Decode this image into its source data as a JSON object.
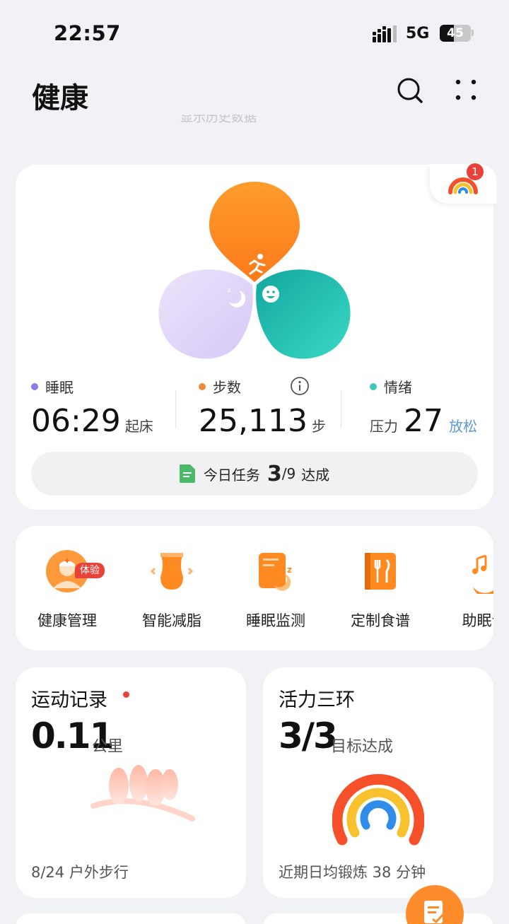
{
  "status_bar": {
    "time": "22:57",
    "network": "5G",
    "battery": "45",
    "battery_level": 0.45
  },
  "header": {
    "title": "健康",
    "faded_text": "显示历史数据",
    "search_icon": "search-icon",
    "more_icon": "more-dots-icon"
  },
  "rings_badge": {
    "count": "1"
  },
  "petal_colors": {
    "sleep": "#e5dcfa",
    "steps": "#ff8a1f",
    "mood": "#22b8aa"
  },
  "metrics": {
    "sleep": {
      "label": "睡眠",
      "value": "06:29",
      "unit": "起床",
      "color": "#8c7ae6"
    },
    "steps": {
      "label": "步数",
      "value": "25,113",
      "unit": "步",
      "color": "#f08a38"
    },
    "mood": {
      "label": "情绪",
      "prefix": "压力",
      "value": "27",
      "status": "放松",
      "color": "#3ec7c0"
    }
  },
  "task": {
    "prefix": "今日任务",
    "done": "3",
    "total": "/9",
    "suffix": "达成"
  },
  "services": [
    {
      "label": "健康管理",
      "icon": "doctor-icon",
      "badge": "体验"
    },
    {
      "label": "智能减脂",
      "icon": "waist-icon"
    },
    {
      "label": "睡眠监测",
      "icon": "sleep-monitor-icon"
    },
    {
      "label": "定制食谱",
      "icon": "recipe-icon"
    },
    {
      "label": "助眠音",
      "icon": "sleep-music-icon"
    }
  ],
  "exercise": {
    "title": "运动记录",
    "value": "0.11",
    "unit": "公里",
    "footer": "8/24 户外步行"
  },
  "vitality": {
    "title": "活力三环",
    "value": "3/3",
    "unit": "目标达成",
    "footer": "近期日均锻炼 38 分钟"
  }
}
